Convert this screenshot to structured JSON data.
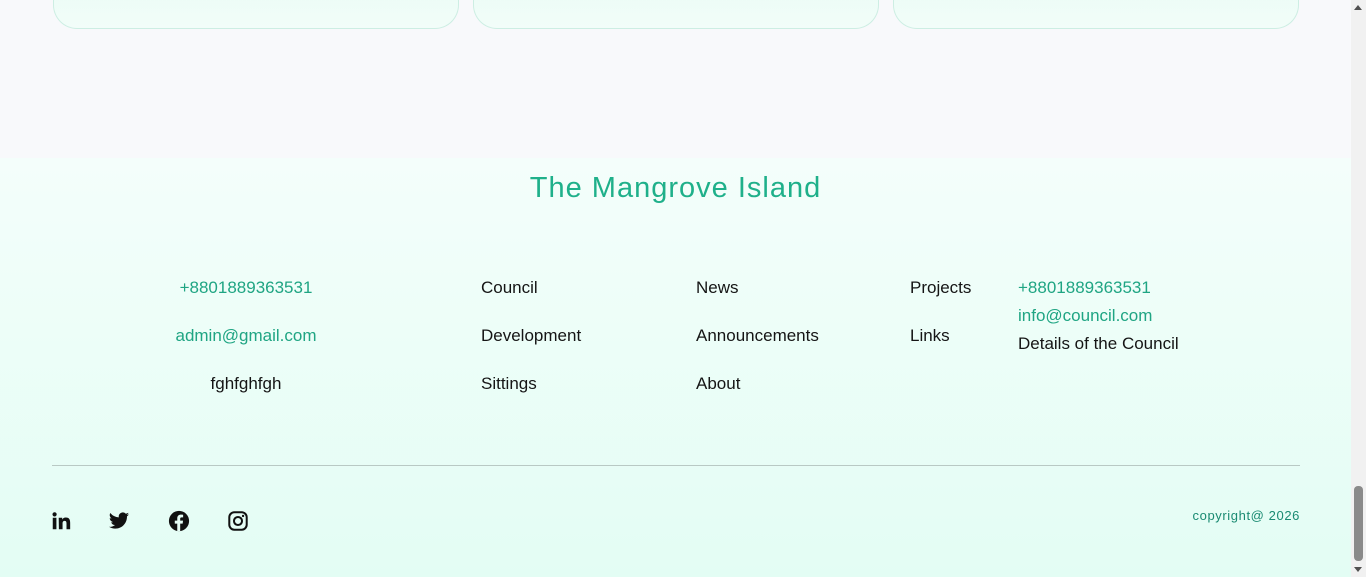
{
  "footer": {
    "brand": "The Mangrove Island",
    "contact": {
      "phone": "+8801889363531",
      "email": "admin@gmail.com",
      "address": "fghfghfgh"
    },
    "links_col1": [
      "Council",
      "Development",
      "Sittings"
    ],
    "links_col2": [
      "News",
      "Announcements",
      "About"
    ],
    "links_col3": [
      "Projects",
      "Links"
    ],
    "contact2": {
      "phone": "+8801889363531",
      "email": "info@council.com",
      "details": "Details of the Council"
    },
    "socials": [
      "linkedin-icon",
      "twitter-icon",
      "facebook-icon",
      "instagram-icon"
    ],
    "copyright": "copyright@ 2026"
  },
  "colors": {
    "brand_green": "#1fb08a",
    "link_green": "#1fa583",
    "copyright_teal": "#1a8a72"
  }
}
